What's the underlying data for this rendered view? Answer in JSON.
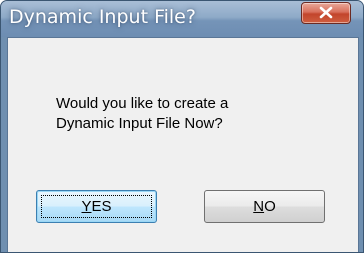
{
  "dialog": {
    "title": "Dynamic Input File?",
    "message_line1": "Would you like to create a",
    "message_line2": "Dynamic Input File Now?",
    "yes_accel": "Y",
    "yes_rest": "ES",
    "no_accel": "N",
    "no_rest": "O",
    "close_icon": "close-x"
  },
  "colors": {
    "titlebar": "#7594b8",
    "close_button": "#c2452c",
    "client_background": "#f0f0f0"
  }
}
